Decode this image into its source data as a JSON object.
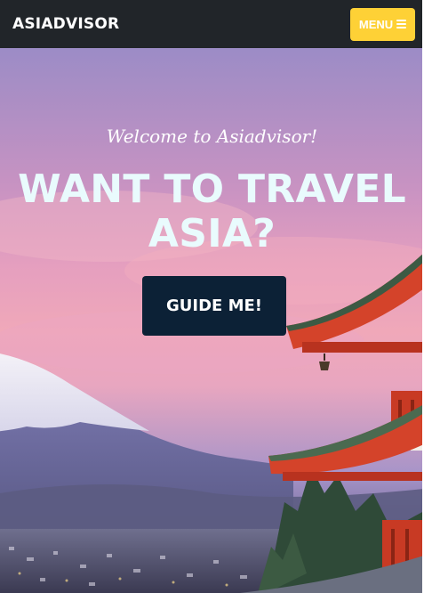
{
  "navbar": {
    "brand": "ASIADVISOR",
    "menu_label": "MENU",
    "menu_icon": "hamburger-icon",
    "bg_color": "#212529",
    "accent_color": "#fed136"
  },
  "hero": {
    "welcome_text": "Welcome to Asiadvisor!",
    "headline": "WANT TO TRAVEL ASIA?",
    "cta_label": "GUIDE ME!",
    "cta_color": "#0c2136",
    "background_image": "sunset-mount-fuji-pagoda"
  }
}
